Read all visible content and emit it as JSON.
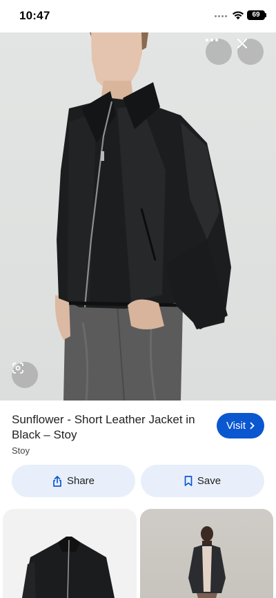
{
  "status_bar": {
    "time": "10:47",
    "battery": "69"
  },
  "hero": {
    "more_icon": "more-horizontal-icon",
    "close_icon": "close-icon",
    "lens_icon": "lens-icon"
  },
  "product": {
    "title": "Sunflower - Short Leather Jacket in Black – Stoy",
    "source": "Stoy",
    "visit_label": "Visit",
    "share_label": "Share",
    "save_label": "Save"
  },
  "colors": {
    "accent": "#0b57d0",
    "pill_background": "#e8effb"
  }
}
